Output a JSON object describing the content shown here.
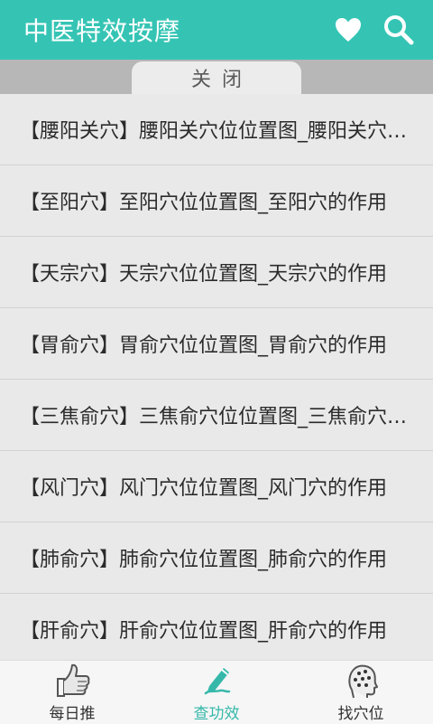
{
  "header": {
    "title": "中医特效按摩",
    "favorite_icon": "heart-icon",
    "search_icon": "search-icon"
  },
  "subbar": {
    "close_label": "关闭"
  },
  "list": {
    "items": [
      {
        "label": "【腰阳关穴】腰阳关穴位位置图_腰阳关穴的作用"
      },
      {
        "label": "【至阳穴】至阳穴位位置图_至阳穴的作用"
      },
      {
        "label": "【天宗穴】天宗穴位位置图_天宗穴的作用"
      },
      {
        "label": "【胃俞穴】胃俞穴位位置图_胃俞穴的作用"
      },
      {
        "label": "【三焦俞穴】三焦俞穴位位置图_三焦俞穴的作用"
      },
      {
        "label": "【风门穴】风门穴位位置图_风门穴的作用"
      },
      {
        "label": "【肺俞穴】肺俞穴位位置图_肺俞穴的作用"
      },
      {
        "label": "【肝俞穴】肝俞穴位位置图_肝俞穴的作用"
      }
    ]
  },
  "bottom_nav": {
    "items": [
      {
        "label": "每日推",
        "icon": "thumbs-up-icon"
      },
      {
        "label": "查功效",
        "icon": "pen-icon",
        "active": true
      },
      {
        "label": "找穴位",
        "icon": "head-acupoint-icon"
      }
    ]
  },
  "colors": {
    "accent": "#35c4b4",
    "active_tab": "#35b8aa"
  }
}
